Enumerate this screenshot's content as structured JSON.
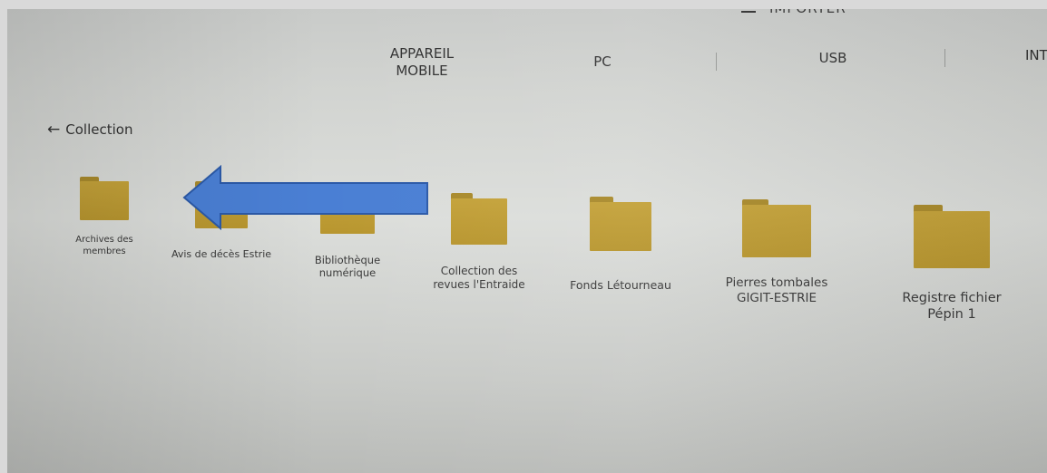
{
  "header": {
    "import_label": "IMPORTER"
  },
  "tabs": [
    {
      "label": "APPAREIL\nMOBILE"
    },
    {
      "label": "PC"
    },
    {
      "label": "USB"
    },
    {
      "label": "INT"
    }
  ],
  "breadcrumb": {
    "back_arrow": "←",
    "label": "Collection"
  },
  "folders": [
    {
      "label": "Archives des membres"
    },
    {
      "label": "Avis de décès Estrie"
    },
    {
      "label": "Bibliothèque numérique"
    },
    {
      "label": "Collection des revues l'Entraide"
    },
    {
      "label": "Fonds Létourneau"
    },
    {
      "label": "Pierres tombales GIGIT-ESTRIE"
    },
    {
      "label": "Registre fichier Pépin 1"
    }
  ],
  "annotation": {
    "arrow_color": "#4a7fd4"
  },
  "colors": {
    "folder": "#b8962f",
    "screen_bg": "#d6d8d5"
  }
}
